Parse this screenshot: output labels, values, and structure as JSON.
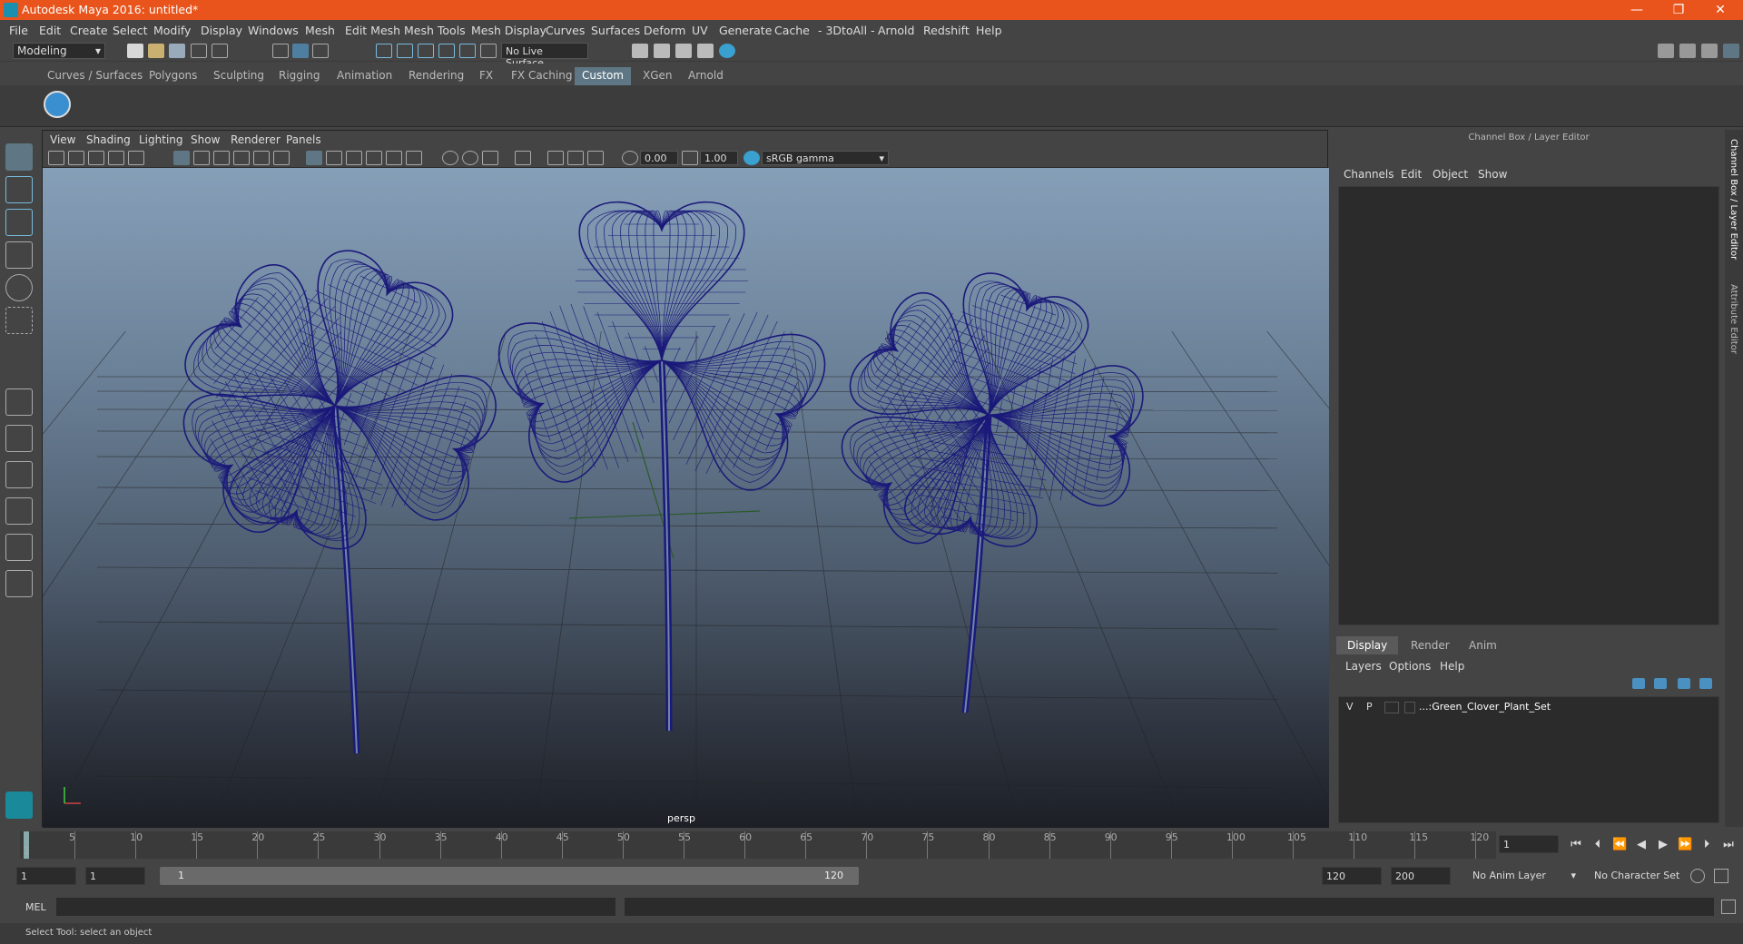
{
  "window": {
    "title": "Autodesk Maya 2016: untitled*",
    "min": "—",
    "max": "❐",
    "close": "✕"
  },
  "menu": [
    "File",
    "Edit",
    "Create",
    "Select",
    "Modify",
    "Display",
    "Windows",
    "Mesh",
    "Edit Mesh",
    "Mesh Tools",
    "Mesh Display",
    "Curves",
    "Surfaces",
    "Deform",
    "UV",
    "Generate",
    "Cache",
    "- 3DtoAll -",
    "Arnold",
    "Redshift",
    "Help"
  ],
  "status": {
    "mode": "Modeling",
    "live_surface": "No Live Surface"
  },
  "shelf_tabs": [
    "Curves / Surfaces",
    "Polygons",
    "Sculpting",
    "Rigging",
    "Animation",
    "Rendering",
    "FX",
    "FX Caching",
    "Custom",
    "XGen",
    "Arnold"
  ],
  "shelf_active": "Custom",
  "viewport": {
    "menu": [
      "View",
      "Shading",
      "Lighting",
      "Show",
      "Renderer",
      "Panels"
    ],
    "exposure": "0.00",
    "gamma": "1.00",
    "color_space": "sRGB gamma",
    "camera": "persp"
  },
  "channel_box": {
    "title": "Channel Box / Layer Editor",
    "menu": [
      "Channels",
      "Edit",
      "Object",
      "Show"
    ]
  },
  "layer_editor": {
    "tabs": [
      "Display",
      "Render",
      "Anim"
    ],
    "active_tab": "Display",
    "menu": [
      "Layers",
      "Options",
      "Help"
    ],
    "layer": {
      "v": "V",
      "p": "P",
      "name": "...:Green_Clover_Plant_Set"
    }
  },
  "side_tabs": {
    "channel": "Channel Box / Layer Editor",
    "attribute": "Attribute Editor"
  },
  "timeline": {
    "ticks": [
      "5",
      "10",
      "15",
      "20",
      "25",
      "30",
      "35",
      "40",
      "45",
      "50",
      "55",
      "60",
      "65",
      "70",
      "75",
      "80",
      "85",
      "90",
      "95",
      "100",
      "105",
      "110",
      "115",
      "120"
    ],
    "start_label": "1",
    "current_frame": "1"
  },
  "range": {
    "start": "1",
    "playback_start": "1",
    "slider_start": "1",
    "slider_end": "120",
    "playback_end": "120",
    "end": "200",
    "anim_layer": "No Anim Layer",
    "character_set": "No Character Set"
  },
  "command": {
    "label": "MEL"
  },
  "help_line": "Select Tool: select an object",
  "colors": {
    "title_bg": "#e8541b",
    "wire": "#1b1a7a",
    "active_tab": "#5f7784"
  }
}
